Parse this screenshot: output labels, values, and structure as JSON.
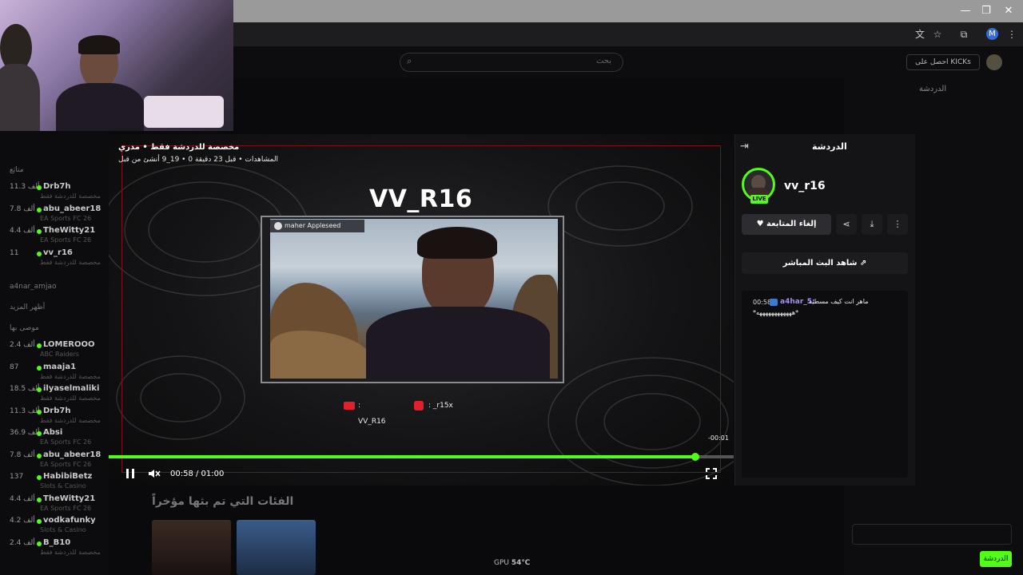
{
  "browser": {
    "window_controls": [
      "—",
      "❐",
      "✕"
    ],
    "profile_initial": "M"
  },
  "header": {
    "search_placeholder": "بحث",
    "kicks_label": "احصل على KICKs"
  },
  "sidebar": {
    "following_heading": "متابَع",
    "followed": [
      {
        "name": "Drb7h",
        "count": "11.3 ألف",
        "category": "مخصصة للدردشة فقط"
      },
      {
        "name": "abu_abeer18",
        "count": "7.8 ألف",
        "category": "EA Sports FC 26"
      },
      {
        "name": "TheWitty21",
        "count": "4.4 ألف",
        "category": "EA Sports FC 26"
      },
      {
        "name": "vv_r16",
        "count": "11",
        "category": "مخصصة للدردشة فقط"
      }
    ],
    "offline_item": "a4nar_amjao",
    "show_more": "أظهر المزيد",
    "recommended_heading": "موصى بها",
    "recommended": [
      {
        "name": "LOMEROOO",
        "count": "2.4 ألف",
        "category": "ABC Raiders"
      },
      {
        "name": "maaja1",
        "count": "87",
        "category": "مخصصة للدردشة فقط"
      },
      {
        "name": "ilyaselmaliki",
        "count": "18.5 ألف",
        "category": "مخصصة للدردشة فقط"
      },
      {
        "name": "Drb7h",
        "count": "11.3 ألف",
        "category": "مخصصة للدردشة فقط"
      },
      {
        "name": "Absi",
        "count": "36.9 ألف",
        "category": "EA Sports FC 26"
      },
      {
        "name": "abu_abeer18",
        "count": "7.8 ألف",
        "category": "EA Sports FC 26"
      },
      {
        "name": "HabibiBetz",
        "count": "137",
        "category": "Slots & Casino"
      },
      {
        "name": "TheWitty21",
        "count": "4.4 ألف",
        "category": "EA Sports FC 26"
      },
      {
        "name": "vodkafunky",
        "count": "4.2 ألف",
        "category": "Slots & Casino"
      },
      {
        "name": "B_B10",
        "count": "2.4 ألف",
        "category": "مخصصة للدردشة فقط"
      }
    ]
  },
  "player": {
    "title_line1": "مخصصة للدردشة فقط • مدري",
    "title_line2": "المشاهدات • قبل 23 دقيقة 0 • 19_9 أنشئ من قبل",
    "overlay_name": "VV_R16",
    "cam_badge": "maher Appleseed",
    "social_youtube": ": VV_R16",
    "social_instagram": ": _r15x",
    "time_remaining": "-00:01",
    "time_display": "00:58 / 01:00",
    "progress": 0.94
  },
  "chat_panel": {
    "title": "الدردشة",
    "streamer_name": "vv_r16",
    "live_badge": "LIVE",
    "unfollow_label": "إلغاء المتابعة",
    "watch_live_label": "شاهد البث المباشر",
    "message": {
      "time": "00:58",
      "user": "a4har_5:",
      "text": "ماهر انت كيف مسطيه",
      "text2": "*ههههههههههههه*"
    }
  },
  "background": {
    "recent_categories": "الفئات التي تم بثها مؤخراً",
    "chat_title": "الدردشة",
    "chat_send": "الدردشة",
    "gpu_label": "GPU",
    "gpu_temp": "54℃"
  },
  "colors": {
    "kick_green": "#53fc18",
    "frame_red": "#7a1018"
  }
}
